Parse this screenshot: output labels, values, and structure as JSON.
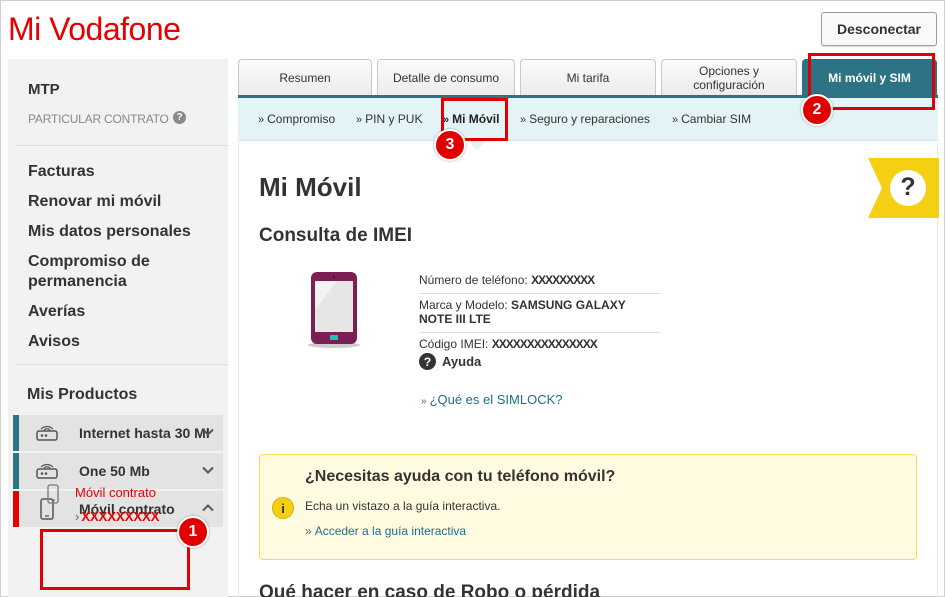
{
  "header": {
    "logo_text": "Mi Vodafone",
    "logout_label": "Desconectar"
  },
  "sidebar": {
    "account_name": "MTP",
    "contract_type": "PARTICULAR CONTRATO",
    "info_glyph": "?",
    "menu": [
      {
        "label": "Facturas"
      },
      {
        "label": "Renovar mi móvil"
      },
      {
        "label": "Mis datos personales"
      },
      {
        "label": "Compromiso de permanencia"
      },
      {
        "label": "Averías"
      },
      {
        "label": "Avisos"
      }
    ],
    "products_title": "Mis Productos",
    "products": [
      {
        "label": "Internet hasta 30 Mb",
        "icon": "router-icon",
        "accent": "#2b7385",
        "expanded": false
      },
      {
        "label": "One 50 Mb",
        "icon": "router-icon",
        "accent": "#2b7385",
        "expanded": false
      },
      {
        "label": "Móvil contrato",
        "icon": "mobile-icon",
        "accent": "#e60000",
        "expanded": true
      }
    ],
    "sub_item": {
      "label": "Móvil contrato",
      "number_prefix": "›",
      "number": "XXXXXXXXX"
    }
  },
  "tabs": [
    {
      "label": "Resumen",
      "active": false
    },
    {
      "label": "Detalle de consumo",
      "active": false
    },
    {
      "label": "Mi tarifa",
      "active": false
    },
    {
      "label": "Opciones y configuración",
      "active": false
    },
    {
      "label": "Mi móvil y SIM",
      "active": true
    }
  ],
  "subtabs": [
    {
      "label": "Compromiso",
      "active": false
    },
    {
      "label": "PIN y PUK",
      "active": false
    },
    {
      "label": "Mi Móvil",
      "active": true
    },
    {
      "label": "Seguro y reparaciones",
      "active": false
    },
    {
      "label": "Cambiar SIM",
      "active": false
    }
  ],
  "content": {
    "page_title": "Mi Móvil",
    "section_title": "Consulta de IMEI",
    "help_badge_glyph": "?",
    "specs": {
      "phone_label": "Número de teléfono:",
      "phone_value": "XXXXXXXXX",
      "model_label": "Marca y Modelo:",
      "model_value": "SAMSUNG GALAXY NOTE III LTE",
      "imei_label": "Código IMEI:",
      "imei_value": "XXXXXXXXXXXXXXX",
      "help_glyph": "?",
      "help_label": "Ayuda"
    },
    "simlock_link": "¿Qué es el SIMLOCK?",
    "help_box": {
      "glyph": "i",
      "title": "¿Necesitas ayuda con tu teléfono móvil?",
      "description": "Echa un vistazo a la guía interactiva.",
      "link": "Acceder a la guía interactiva"
    },
    "bottom_title": "Qué hacer en caso de Robo o pérdida"
  },
  "annotations": [
    {
      "number": "1"
    },
    {
      "number": "2"
    },
    {
      "number": "3"
    }
  ],
  "colors": {
    "brand_red": "#e60000",
    "tab_teal": "#2b7385",
    "subtab_bg": "#e3f3f6",
    "help_yellow": "#f5cf14",
    "phone_purple": "#7b1f55"
  }
}
